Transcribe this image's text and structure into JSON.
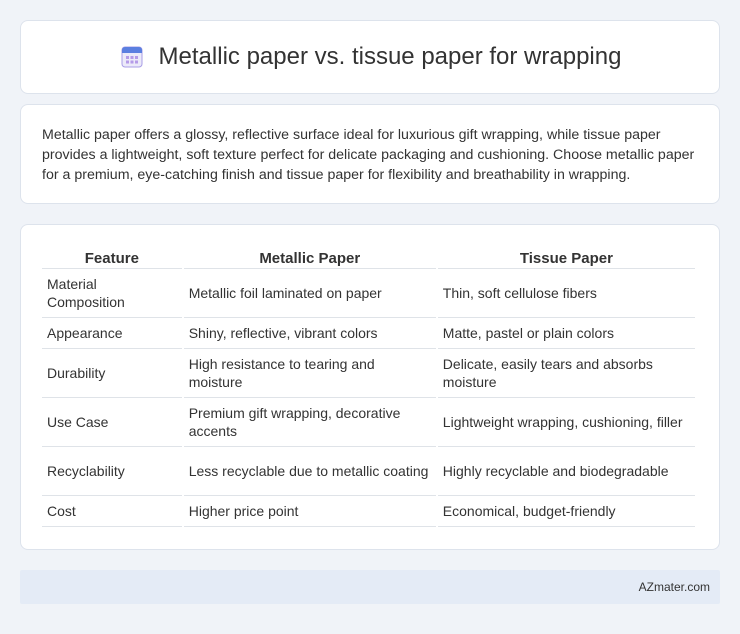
{
  "title": "Metallic paper vs. tissue paper for wrapping",
  "summary": "Metallic paper offers a glossy, reflective surface ideal for luxurious gift wrapping, while tissue paper provides a lightweight, soft texture perfect for delicate packaging and cushioning. Choose metallic paper for a premium, eye-catching finish and tissue paper for flexibility and breathability in wrapping.",
  "table": {
    "headers": [
      "Feature",
      "Metallic Paper",
      "Tissue Paper"
    ],
    "rows": [
      [
        "Material Composition",
        "Metallic foil laminated on paper",
        "Thin, soft cellulose fibers"
      ],
      [
        "Appearance",
        "Shiny, reflective, vibrant colors",
        "Matte, pastel or plain colors"
      ],
      [
        "Durability",
        "High resistance to tearing and moisture",
        "Delicate, easily tears and absorbs moisture"
      ],
      [
        "Use Case",
        "Premium gift wrapping, decorative accents",
        "Lightweight wrapping, cushioning, filler"
      ],
      [
        "Recyclability",
        "Less recyclable due to metallic coating",
        "Highly recyclable and biodegradable"
      ],
      [
        "Cost",
        "Higher price point",
        "Economical, budget-friendly"
      ]
    ]
  },
  "footer": "AZmater.com",
  "icon": "calendar-icon"
}
